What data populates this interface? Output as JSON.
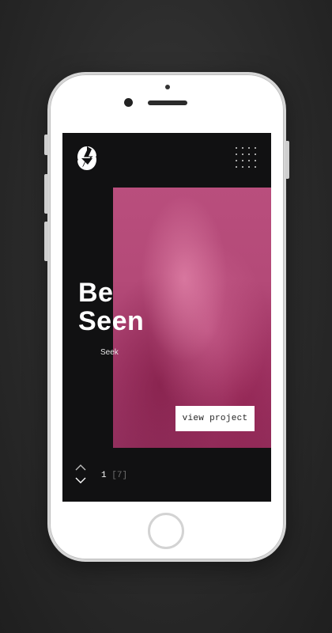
{
  "app": {
    "logo_icon": "brand-logo-icon",
    "menu_icon": "grid-menu-icon"
  },
  "hero": {
    "title_line1": "Be",
    "title_line2": "Seen",
    "subtitle": "Seek",
    "cta_label": "view project",
    "image_color": "#b44a78"
  },
  "pager": {
    "current": "1",
    "total_open": "[",
    "total": "7",
    "total_close": "]",
    "prev_icon": "chevron-up-icon",
    "next_icon": "chevron-down-icon"
  },
  "colors": {
    "screen_bg": "#111112",
    "accent": "#b44a78",
    "text": "#ffffff"
  }
}
